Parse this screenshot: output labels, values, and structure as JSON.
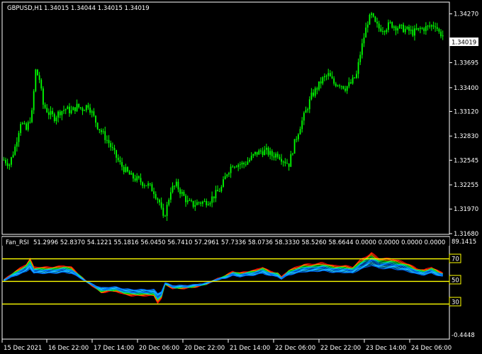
{
  "header": {
    "symbol": "GBPUSD,H1",
    "ohlc": "1.34015 1.34044 1.34015 1.34019"
  },
  "indicator": {
    "name": "Fan_RSI",
    "values_text": "51.2996 52.8370 54.1221 55.1816 56.0450 56.7410 57.2961 57.7336 58.0736 58.3330 58.5260 58.6644 0.0000 0.0000 0.0000 0.0000",
    "level_labels": [
      "70",
      "50",
      "30"
    ],
    "axis_top": "89.1415",
    "axis_bottom": "-0.4448"
  },
  "colors": {
    "background": "#000000",
    "bull_candle": "#00ff00",
    "grid_border": "#ffffff",
    "level_line": "#ffff00",
    "fan": [
      "#ff0000",
      "#ff4400",
      "#ff8800",
      "#00ff00",
      "#00dd88",
      "#00cccc",
      "#0088ff",
      "#0066ff",
      "#00aaff",
      "#33ccff",
      "#00aaff",
      "#0066ff"
    ]
  },
  "chart_data": [
    {
      "type": "candlestick",
      "title": "GBPUSD,H1",
      "ylim": [
        1.3168,
        1.344
      ],
      "y_ticks": [
        "1.34270",
        "1.34019",
        "1.33695",
        "1.33400",
        "1.33120",
        "1.32830",
        "1.32545",
        "1.32255",
        "1.31970",
        "1.31680"
      ],
      "current_price": "1.34019",
      "x_ticks": [
        "15 Dec 2021",
        "16 Dec 22:00",
        "17 Dec 14:00",
        "20 Dec 06:00",
        "20 Dec 22:00",
        "21 Dec 14:00",
        "22 Dec 06:00",
        "22 Dec 22:00",
        "23 Dec 14:00",
        "24 Dec 06:00"
      ],
      "close_path": [
        [
          0,
          1.3255
        ],
        [
          3,
          1.325
        ],
        [
          6,
          1.327
        ],
        [
          9,
          1.33
        ],
        [
          12,
          1.329
        ],
        [
          15,
          1.331
        ],
        [
          17,
          1.336
        ],
        [
          19,
          1.335
        ],
        [
          21,
          1.332
        ],
        [
          24,
          1.331
        ],
        [
          27,
          1.3305
        ],
        [
          30,
          1.3312
        ],
        [
          33,
          1.3315
        ],
        [
          36,
          1.3312
        ],
        [
          39,
          1.3318
        ],
        [
          42,
          1.3315
        ],
        [
          45,
          1.332
        ],
        [
          47,
          1.331
        ],
        [
          50,
          1.3295
        ],
        [
          53,
          1.3285
        ],
        [
          56,
          1.3275
        ],
        [
          59,
          1.3262
        ],
        [
          62,
          1.325
        ],
        [
          65,
          1.3242
        ],
        [
          68,
          1.3235
        ],
        [
          71,
          1.3232
        ],
        [
          74,
          1.3228
        ],
        [
          77,
          1.3225
        ],
        [
          80,
          1.3218
        ],
        [
          83,
          1.3205
        ],
        [
          85,
          1.3185
        ],
        [
          87,
          1.32
        ],
        [
          89,
          1.322
        ],
        [
          92,
          1.3225
        ],
        [
          95,
          1.3215
        ],
        [
          98,
          1.3205
        ],
        [
          101,
          1.3202
        ],
        [
          104,
          1.3205
        ],
        [
          107,
          1.3205
        ],
        [
          110,
          1.3208
        ],
        [
          113,
          1.3215
        ],
        [
          116,
          1.3222
        ],
        [
          119,
          1.324
        ],
        [
          122,
          1.325
        ],
        [
          125,
          1.325
        ],
        [
          128,
          1.325
        ],
        [
          131,
          1.3255
        ],
        [
          134,
          1.3262
        ],
        [
          137,
          1.3265
        ],
        [
          140,
          1.3265
        ],
        [
          143,
          1.326
        ],
        [
          146,
          1.3262
        ],
        [
          149,
          1.3255
        ],
        [
          152,
          1.325
        ],
        [
          155,
          1.3275
        ],
        [
          158,
          1.3295
        ],
        [
          161,
          1.3312
        ],
        [
          164,
          1.333
        ],
        [
          167,
          1.334
        ],
        [
          170,
          1.335
        ],
        [
          173,
          1.3355
        ],
        [
          176,
          1.3345
        ],
        [
          179,
          1.3345
        ],
        [
          182,
          1.334
        ],
        [
          185,
          1.3345
        ],
        [
          188,
          1.3355
        ],
        [
          190,
          1.338
        ],
        [
          192,
          1.34
        ],
        [
          194,
          1.3418
        ],
        [
          196,
          1.3425
        ],
        [
          198,
          1.3415
        ],
        [
          200,
          1.341
        ],
        [
          203,
          1.341
        ],
        [
          206,
          1.3415
        ],
        [
          209,
          1.3412
        ],
        [
          212,
          1.341
        ],
        [
          215,
          1.3408
        ],
        [
          218,
          1.3405
        ],
        [
          221,
          1.3408
        ],
        [
          224,
          1.341
        ],
        [
          227,
          1.3412
        ],
        [
          230,
          1.3415
        ],
        [
          232,
          1.3405
        ],
        [
          234,
          1.3402
        ]
      ]
    },
    {
      "type": "line",
      "title": "Fan_RSI",
      "ylim": [
        -0.4448,
        89.1415
      ],
      "levels": [
        70,
        50,
        30
      ],
      "series_count": 12,
      "rsi_path": [
        [
          0,
          51
        ],
        [
          6,
          57
        ],
        [
          12,
          62
        ],
        [
          14,
          66
        ],
        [
          16,
          60
        ],
        [
          20,
          60
        ],
        [
          26,
          60
        ],
        [
          32,
          61
        ],
        [
          36,
          60
        ],
        [
          40,
          55
        ],
        [
          44,
          50
        ],
        [
          48,
          46
        ],
        [
          52,
          42
        ],
        [
          56,
          43
        ],
        [
          60,
          43
        ],
        [
          64,
          41
        ],
        [
          68,
          40
        ],
        [
          72,
          40
        ],
        [
          76,
          40
        ],
        [
          80,
          40
        ],
        [
          82,
          35
        ],
        [
          84,
          38
        ],
        [
          86,
          48
        ],
        [
          90,
          45
        ],
        [
          96,
          45
        ],
        [
          102,
          46
        ],
        [
          108,
          48
        ],
        [
          114,
          52
        ],
        [
          118,
          54
        ],
        [
          122,
          57
        ],
        [
          126,
          56
        ],
        [
          130,
          57
        ],
        [
          134,
          58
        ],
        [
          138,
          60
        ],
        [
          142,
          57
        ],
        [
          146,
          56
        ],
        [
          148,
          53
        ],
        [
          152,
          58
        ],
        [
          156,
          60
        ],
        [
          160,
          62
        ],
        [
          164,
          62
        ],
        [
          170,
          63
        ],
        [
          176,
          61
        ],
        [
          182,
          61
        ],
        [
          186,
          60
        ],
        [
          190,
          65
        ],
        [
          194,
          68
        ],
        [
          196,
          70
        ],
        [
          200,
          66
        ],
        [
          206,
          66
        ],
        [
          212,
          64
        ],
        [
          216,
          62
        ],
        [
          220,
          59
        ],
        [
          224,
          58
        ],
        [
          228,
          60
        ],
        [
          232,
          57
        ],
        [
          234,
          56
        ]
      ]
    }
  ]
}
